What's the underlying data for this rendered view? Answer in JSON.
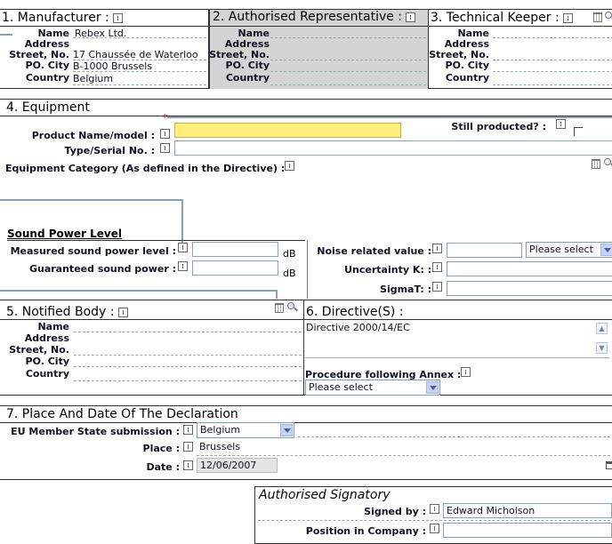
{
  "manufacturer": {
    "title": "1. Manufacturer :",
    "name_label": "Name",
    "name_value": "Rebex Ltd.",
    "address_label": "Address",
    "street_label": "Street, No.",
    "street_value": "17 Chaussée de Waterloo",
    "pocity_label": "PO. City",
    "pocity_value": "B-1000 Brussels",
    "country_label": "Country",
    "country_value": "Belgium"
  },
  "representative": {
    "title": "2. Authorised Representative :",
    "name_label": "Name",
    "address_label": "Address",
    "street_label": "Street, No.",
    "pocity_label": "PO. City",
    "country_label": "Country"
  },
  "keeper": {
    "title": "3. Technical Keeper :",
    "name_label": "Name",
    "address_label": "Address",
    "street_label": "Street, No.",
    "pocity_label": "PO. City",
    "country_label": "Country"
  },
  "equipment": {
    "title": "4. Equipment",
    "required_mark": "*",
    "product_label": "Product Name/model :",
    "product_value": "",
    "still_label": "Still producted? :",
    "type_label": "Type/Serial No. :",
    "category_label": "Equipment Category (As defined in the Directive) :",
    "sound_title": "Sound Power Level",
    "measured_label": "Measured sound power level :",
    "guaranteed_label": "Guaranteed sound power :",
    "unit_db": "dB",
    "noise_label": "Noise related value :",
    "noise_select": "Please select",
    "uncertainty_label": "Uncertainty K: :",
    "sigma_label": "SigmaT: :"
  },
  "notified": {
    "title": "5. Notified Body :",
    "name_label": "Name",
    "address_label": "Address",
    "street_label": "Street, No.",
    "pocity_label": "PO. City",
    "country_label": "Country"
  },
  "directive": {
    "title": "6. Directive(S) :",
    "list_value": "Directive 2000/14/EC",
    "procedure_label": "Procedure following Annex :",
    "procedure_select": "Please select"
  },
  "place": {
    "title": "7. Place And Date Of The Declaration",
    "member_label": "EU Member State submission :",
    "member_value": "Belgium",
    "place_label": "Place :",
    "place_value": "Brussels",
    "date_label": "Date :",
    "date_value": "12/06/2007"
  },
  "signatory": {
    "title": "Authorised Signatory",
    "signed_label": "Signed by :",
    "signed_value": "Edward Micholson",
    "position_label": "Position in Company :",
    "position_value": ""
  },
  "colors": {
    "highlight_field": "#ffef7a",
    "rep_background": "#d4d4d4",
    "connector_line": "#8a9fb8"
  }
}
